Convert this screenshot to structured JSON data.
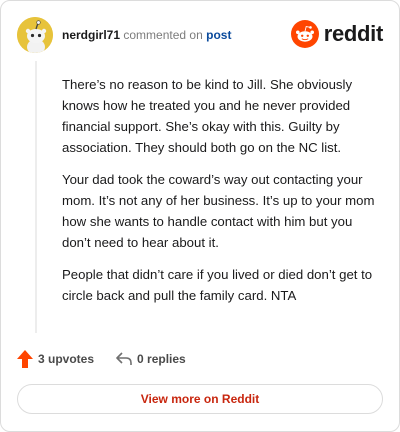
{
  "header": {
    "username": "nerdgirl71",
    "commented_text": "commented on",
    "post_link": "post",
    "brand": "reddit",
    "avatar_icon": "snoo-avatar-icon",
    "brand_icon": "reddit-alien-icon",
    "brand_color": "#ff4500"
  },
  "comment": {
    "paragraphs": [
      "There’s no reason to be kind to Jill. She obviously knows how he treated you and he never provided financial support. She’s okay with this. Guilty by association. They should both go on the NC list.",
      "Your dad took the coward’s way out contacting your mom. It’s not any of her business. It’s up to your mom how she wants to handle contact with him but you don’t need to hear about it.",
      "People that didn’t care if you lived or died don’t get to circle back and pull the family card. NTA"
    ]
  },
  "actions": {
    "upvotes": "3 upvotes",
    "replies": "0 replies",
    "upvote_icon": "upvote-arrow-icon",
    "reply_icon": "reply-arrow-icon"
  },
  "footer": {
    "view_more": "View more on Reddit",
    "link_color": "#c8260e"
  }
}
